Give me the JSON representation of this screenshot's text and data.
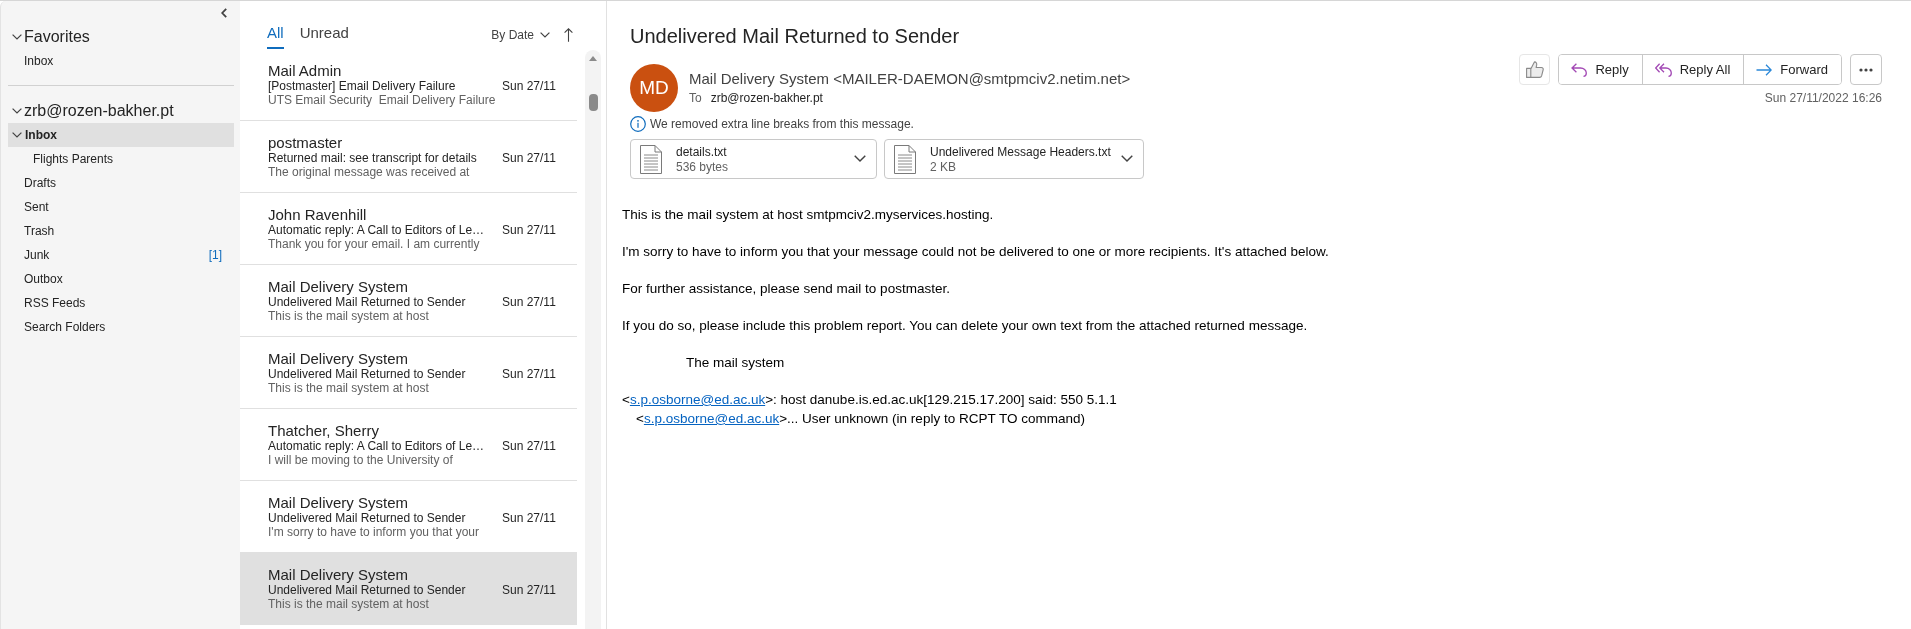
{
  "sidebar": {
    "sections": [
      {
        "title": "Favorites",
        "expanded": true,
        "items": [
          {
            "label": "Inbox",
            "selected": false
          }
        ]
      },
      {
        "title": "zrb@rozen-bakher.pt",
        "expanded": true,
        "items": [
          {
            "label": "Inbox",
            "selected": true,
            "expanded": true,
            "children": [
              {
                "label": "Flights Parents",
                "selected": false
              }
            ]
          },
          {
            "label": "Drafts",
            "selected": false
          },
          {
            "label": "Sent",
            "selected": false
          },
          {
            "label": "Trash",
            "selected": false
          },
          {
            "label": "Junk",
            "selected": false,
            "count": "[1]"
          },
          {
            "label": "Outbox",
            "selected": false
          },
          {
            "label": "RSS Feeds",
            "selected": false
          },
          {
            "label": "Search Folders",
            "selected": false
          }
        ]
      }
    ]
  },
  "message_list": {
    "tabs": [
      {
        "label": "All",
        "selected": true
      },
      {
        "label": "Unread",
        "selected": false
      }
    ],
    "sort": "By Date",
    "messages": [
      {
        "sender": "Mail Admin",
        "subject": "[Postmaster] Email Delivery Failure",
        "date": "Sun 27/11",
        "preview": "UTS Email Security  Email Delivery Failure",
        "selected": false
      },
      {
        "sender": "postmaster",
        "subject": "Returned mail: see transcript for details",
        "date": "Sun 27/11",
        "preview": "The original message was received at",
        "selected": false
      },
      {
        "sender": "John Ravenhill",
        "subject": "Automatic reply: A Call to Editors of Le…",
        "date": "Sun 27/11",
        "preview": "Thank you for your email. I am currently",
        "selected": false
      },
      {
        "sender": "Mail Delivery System",
        "subject": "Undelivered Mail Returned to Sender",
        "date": "Sun 27/11",
        "preview": "This is the mail system at host",
        "selected": false
      },
      {
        "sender": "Mail Delivery System",
        "subject": "Undelivered Mail Returned to Sender",
        "date": "Sun 27/11",
        "preview": "This is the mail system at host",
        "selected": false
      },
      {
        "sender": "Thatcher, Sherry",
        "subject": "Automatic reply: A Call to Editors of Le…",
        "date": "Sun 27/11",
        "preview": "I will be moving to the University of",
        "selected": false
      },
      {
        "sender": "Mail Delivery System",
        "subject": "Undelivered Mail Returned to Sender",
        "date": "Sun 27/11",
        "preview": "I'm sorry to have to inform you that your",
        "selected": false
      },
      {
        "sender": "Mail Delivery System",
        "subject": "Undelivered Mail Returned to Sender",
        "date": "Sun 27/11",
        "preview": "This is the mail system at host",
        "selected": true
      }
    ]
  },
  "reading_pane": {
    "subject": "Undelivered Mail Returned to Sender",
    "sender": {
      "initials": "MD",
      "name": "Mail Delivery System <MAILER-DAEMON@smtpmciv2.netim.net>"
    },
    "recipient": {
      "label": "To",
      "address": "zrb@rozen-bakher.pt"
    },
    "notice": "We removed extra line breaks from this message.",
    "attachments": [
      {
        "name": "details.txt",
        "size": "536 bytes"
      },
      {
        "name": "Undelivered Message Headers.txt",
        "size": "2 KB"
      }
    ],
    "actions": [
      {
        "kind": "reply",
        "label": "Reply"
      },
      {
        "kind": "reply_all",
        "label": "Reply All"
      },
      {
        "kind": "forward",
        "label": "Forward"
      }
    ],
    "date": "Sun 27/11/2022 16:26",
    "body": [
      {
        "lines": [
          {
            "kind": "flush",
            "parts": [
              {
                "kind": "text",
                "text": "This is the mail system at host smtpmciv2.myservices.hosting."
              }
            ]
          }
        ]
      },
      {
        "lines": [
          {
            "kind": "flush",
            "parts": [
              {
                "kind": "text",
                "text": "I'm sorry to have to inform you that your message could not be delivered to one or more recipients. It's attached below."
              }
            ]
          }
        ]
      },
      {
        "lines": [
          {
            "kind": "flush",
            "parts": [
              {
                "kind": "text",
                "text": "For further assistance, please send mail to postmaster."
              }
            ]
          }
        ]
      },
      {
        "lines": [
          {
            "kind": "flush",
            "parts": [
              {
                "kind": "text",
                "text": "If you do so, please include this problem report. You can delete your own text from the attached returned message."
              }
            ]
          }
        ]
      },
      {
        "lines": [
          {
            "kind": "tabbed",
            "parts": [
              {
                "kind": "text",
                "text": "The mail system"
              }
            ]
          }
        ]
      },
      {
        "lines": [
          {
            "kind": "flush",
            "parts": [
              {
                "kind": "text",
                "text": "<"
              },
              {
                "kind": "link",
                "text": "s.p.osborne@ed.ac.uk"
              },
              {
                "kind": "text",
                "text": ">: host danube.is.ed.ac.uk[129.215.17.200] said: 550 5.1.1"
              }
            ]
          },
          {
            "kind": "inset",
            "parts": [
              {
                "kind": "text",
                "text": "<"
              },
              {
                "kind": "link",
                "text": "s.p.osborne@ed.ac.uk"
              },
              {
                "kind": "text",
                "text": ">... User unknown (in reply to RCPT TO command)"
              }
            ]
          }
        ]
      }
    ]
  }
}
